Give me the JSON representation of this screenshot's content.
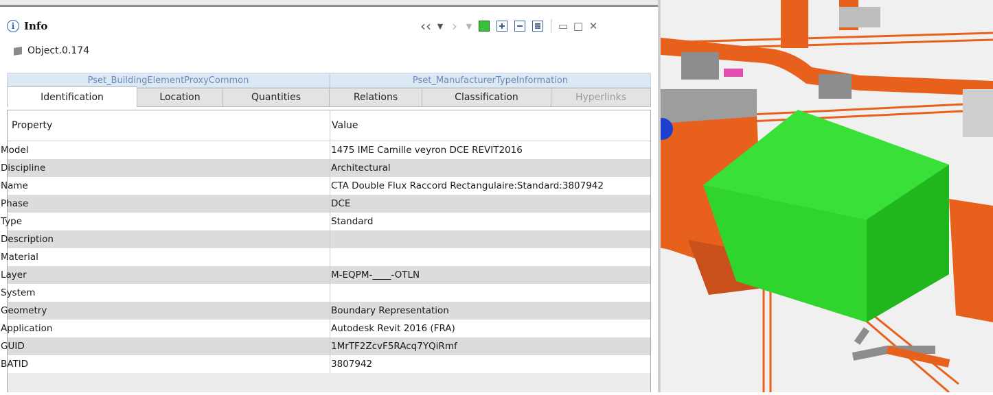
{
  "panel": {
    "title": "Info",
    "object_label": "Object.0.174",
    "toolbar": {
      "back": "‹‹",
      "dropdown": "▼",
      "forward": "›",
      "restore": "▭",
      "maximize": "□",
      "close": "✕"
    }
  },
  "tabs": {
    "top": [
      {
        "label": "Pset_BuildingElementProxyCommon"
      },
      {
        "label": "Pset_ManufacturerTypeInformation"
      }
    ],
    "bottom": [
      {
        "label": "Identification",
        "selected": true
      },
      {
        "label": "Location"
      },
      {
        "label": "Quantities"
      },
      {
        "label": "Relations"
      },
      {
        "label": "Classification"
      },
      {
        "label": "Hyperlinks",
        "disabled": true
      }
    ]
  },
  "table": {
    "header": {
      "property": "Property",
      "value": "Value"
    },
    "rows": [
      {
        "property": "Model",
        "value": "1475 IME Camille veyron DCE REVIT2016"
      },
      {
        "property": "Discipline",
        "value": "Architectural"
      },
      {
        "property": "Name",
        "value": "CTA Double Flux Raccord Rectangulaire:Standard:3807942"
      },
      {
        "property": "Phase",
        "value": "DCE"
      },
      {
        "property": "Type",
        "value": "Standard"
      },
      {
        "property": "Description",
        "value": ""
      },
      {
        "property": "Material",
        "value": ""
      },
      {
        "property": "Layer",
        "value": "M-EQPM-____-OTLN"
      },
      {
        "property": "System",
        "value": ""
      },
      {
        "property": "Geometry",
        "value": "Boundary Representation"
      },
      {
        "property": "Application",
        "value": "Autodesk Revit 2016 (FRA)"
      },
      {
        "property": "GUID",
        "value": "1MrTF2ZcvF5RAcq7YQiRmf"
      },
      {
        "property": "BATID",
        "value": "3807942"
      }
    ]
  },
  "colors": {
    "duct_orange": "#e8611c",
    "duct_grey": "#8d8d8d",
    "selected_green": "#2dd62a",
    "accent_blue": "#2a62b6"
  }
}
